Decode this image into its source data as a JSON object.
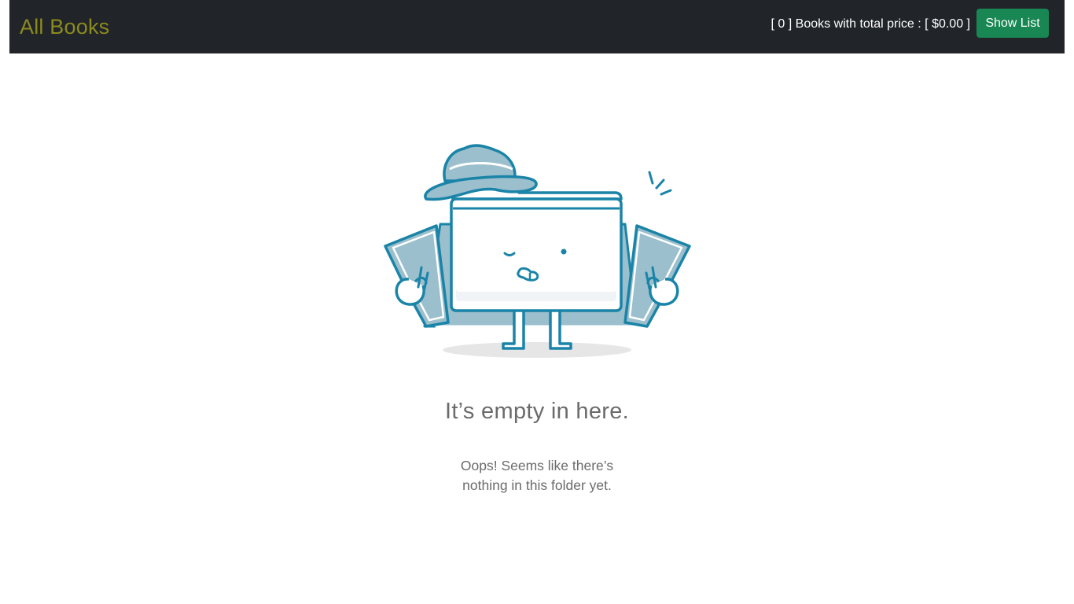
{
  "navbar": {
    "brand": "All Books",
    "cart_summary": {
      "count_text": "[ 0 ]",
      "middle_text": " Books with total price : ",
      "price_text": "[ $0.00 ]"
    },
    "show_list_label": "Show List"
  },
  "empty_state": {
    "title": "It’s empty in here.",
    "line1": "Oops! Seems like there’s",
    "line2": "nothing in this folder yet.",
    "illustration_icon": "empty-folder-detective-icon"
  },
  "colors": {
    "navbar_bg": "#212529",
    "brand": "#8b8b1e",
    "button": "#198754",
    "illustration_blue": "#1a84a8",
    "illustration_fill": "#9bbfcc",
    "text_gray": "#6b6b6b"
  }
}
